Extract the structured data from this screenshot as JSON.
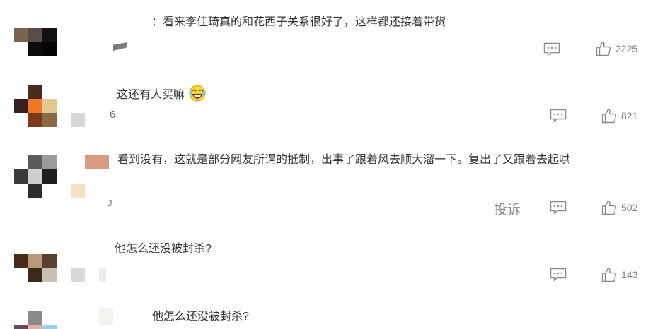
{
  "comments": [
    {
      "text": "：看来李佳琦真的和花西子关系很好了，这样都还接着带货",
      "likes": "2225",
      "reply_icon": "comment-icon",
      "like_icon": "thumbs-up-icon"
    },
    {
      "text": "这还有人买嘛",
      "emoji": "laughing-tears-emoji",
      "extra": "6",
      "likes": "821",
      "reply_icon": "comment-icon",
      "like_icon": "thumbs-up-icon"
    },
    {
      "text": "看到没有，这就是部分网友所谓的抵制，出事了跟着风去顺大溜一下。复出了又跟着去起哄",
      "extra": "J",
      "report": "投诉",
      "likes": "502",
      "reply_icon": "comment-icon",
      "like_icon": "thumbs-up-icon"
    },
    {
      "text": "他怎么还没被封杀?",
      "likes": "143",
      "reply_icon": "comment-icon",
      "like_icon": "thumbs-up-icon"
    },
    {
      "text": "他怎么还没被封杀?"
    }
  ],
  "colors": {
    "text": "#333333",
    "muted": "#808080",
    "icon": "#8a8a8a"
  }
}
